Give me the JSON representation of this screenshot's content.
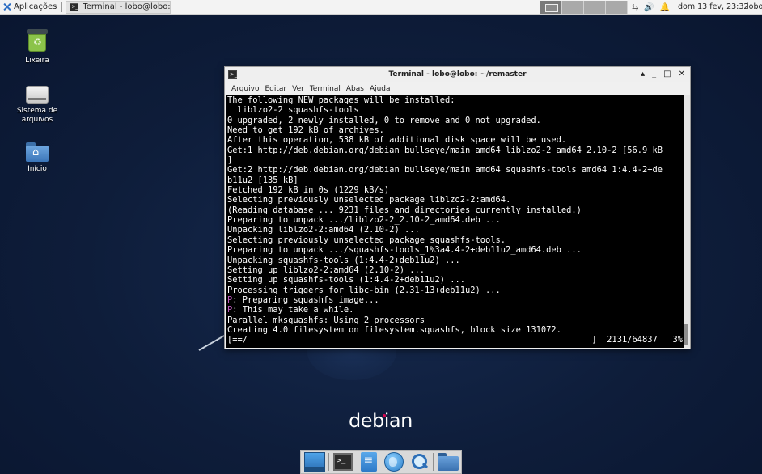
{
  "top_panel": {
    "apps_label": "Aplicações",
    "task_label": "Terminal - lobo@lobo: ~...",
    "clock": "dom 13 fev, 23:32",
    "user": "lobo"
  },
  "desktop_icons": [
    {
      "label": "Lixeira",
      "icon": "trash-icon"
    },
    {
      "label": "Sistema de arquivos",
      "icon": "drive-icon"
    },
    {
      "label": "Início",
      "icon": "home-folder-icon"
    }
  ],
  "terminal": {
    "title": "Terminal - lobo@lobo: ~/remaster",
    "controls": {
      "up": "▴",
      "minimize": "_",
      "maximize": "□",
      "close": "✕"
    },
    "menu": [
      "Arquivo",
      "Editar",
      "Ver",
      "Terminal",
      "Abas",
      "Ajuda"
    ],
    "lines": [
      "The following NEW packages will be installed:",
      "  liblzo2-2 squashfs-tools",
      "0 upgraded, 2 newly installed, 0 to remove and 0 not upgraded.",
      "Need to get 192 kB of archives.",
      "After this operation, 538 kB of additional disk space will be used.",
      "Get:1 http://deb.debian.org/debian bullseye/main amd64 liblzo2-2 amd64 2.10-2 [56.9 kB",
      "]",
      "Get:2 http://deb.debian.org/debian bullseye/main amd64 squashfs-tools amd64 1:4.4-2+de",
      "b11u2 [135 kB]",
      "Fetched 192 kB in 0s (1229 kB/s)",
      "Selecting previously unselected package liblzo2-2:amd64.",
      "(Reading database ... 9231 files and directories currently installed.)",
      "Preparing to unpack .../liblzo2-2_2.10-2_amd64.deb ...",
      "Unpacking liblzo2-2:amd64 (2.10-2) ...",
      "Selecting previously unselected package squashfs-tools.",
      "Preparing to unpack .../squashfs-tools_1%3a4.4-2+deb11u2_amd64.deb ...",
      "Unpacking squashfs-tools (1:4.4-2+deb11u2) ...",
      "Setting up liblzo2-2:amd64 (2.10-2) ...",
      "Setting up squashfs-tools (1:4.4-2+deb11u2) ...",
      "Processing triggers for libc-bin (2.31-13+deb11u2) ..."
    ],
    "p_lines": [
      {
        "prefix": "P",
        "text": ": Preparing squashfs image..."
      },
      {
        "prefix": "P",
        "text": ": This may take a while."
      }
    ],
    "tail_lines": [
      "Parallel mksquashfs: Using 2 processors",
      "Creating 4.0 filesystem on filesystem.squashfs, block size 131072."
    ],
    "progress_line": "[==/                                                                    ]  2131/64837   3%",
    "progress_fraction": 0.03
  },
  "logo": "debian",
  "colors": {
    "desktop_bg": "#0e1d3a",
    "panel_bg": "#f3f3f3",
    "terminal_bg": "#000000",
    "prompt_p": "#c05cc0",
    "debian_red": "#d70751"
  },
  "dock": [
    "show-desktop-icon",
    "terminal-icon",
    "file-manager-icon",
    "web-browser-icon",
    "app-finder-icon",
    "folder-icon"
  ]
}
